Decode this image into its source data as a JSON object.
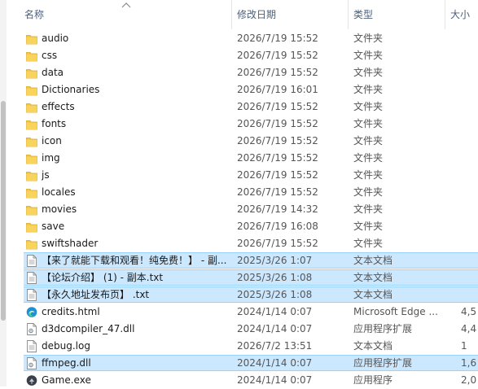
{
  "header": {
    "name": "名称",
    "date_modified": "修改日期",
    "type": "类型",
    "size": "大小"
  },
  "colors": {
    "selection_bg": "#cce8ff",
    "selection_border": "#99d1ff",
    "folder": "#f4c542",
    "header_text": "#4c607a"
  },
  "rows": [
    {
      "name": "audio",
      "date": "2026/7/19 15:52",
      "type": "文件夹",
      "size": "",
      "icon": "folder-icon"
    },
    {
      "name": "css",
      "date": "2026/7/19 15:52",
      "type": "文件夹",
      "size": "",
      "icon": "folder-icon"
    },
    {
      "name": "data",
      "date": "2026/7/19 15:52",
      "type": "文件夹",
      "size": "",
      "icon": "folder-icon"
    },
    {
      "name": "Dictionaries",
      "date": "2026/7/19 16:01",
      "type": "文件夹",
      "size": "",
      "icon": "folder-icon"
    },
    {
      "name": "effects",
      "date": "2026/7/19 15:52",
      "type": "文件夹",
      "size": "",
      "icon": "folder-icon"
    },
    {
      "name": "fonts",
      "date": "2026/7/19 15:52",
      "type": "文件夹",
      "size": "",
      "icon": "folder-icon"
    },
    {
      "name": "icon",
      "date": "2026/7/19 15:52",
      "type": "文件夹",
      "size": "",
      "icon": "folder-icon"
    },
    {
      "name": "img",
      "date": "2026/7/19 15:52",
      "type": "文件夹",
      "size": "",
      "icon": "folder-icon"
    },
    {
      "name": "js",
      "date": "2026/7/19 15:52",
      "type": "文件夹",
      "size": "",
      "icon": "folder-icon"
    },
    {
      "name": "locales",
      "date": "2026/7/19 15:52",
      "type": "文件夹",
      "size": "",
      "icon": "folder-icon"
    },
    {
      "name": "movies",
      "date": "2026/7/19 14:32",
      "type": "文件夹",
      "size": "",
      "icon": "folder-icon"
    },
    {
      "name": "save",
      "date": "2026/7/19 16:08",
      "type": "文件夹",
      "size": "",
      "icon": "folder-icon"
    },
    {
      "name": "swiftshader",
      "date": "2026/7/19 15:52",
      "type": "文件夹",
      "size": "",
      "icon": "folder-icon"
    },
    {
      "name": "【来了就能下载和观看！纯免费！】 - 副...",
      "date": "2025/3/26 1:07",
      "type": "文本文档",
      "size": "",
      "icon": "text-file-icon",
      "selected": true
    },
    {
      "name": "【论坛介绍】 (1) - 副本.txt",
      "date": "2025/3/26 1:08",
      "type": "文本文档",
      "size": "",
      "icon": "text-file-icon",
      "selected": true
    },
    {
      "name": "【永久地址发布页】 .txt",
      "date": "2025/3/26 1:08",
      "type": "文本文档",
      "size": "",
      "icon": "text-file-icon",
      "selected": true
    },
    {
      "name": "credits.html",
      "date": "2024/1/14 0:07",
      "type": "Microsoft Edge ...",
      "size": "4,5",
      "icon": "edge-icon"
    },
    {
      "name": "d3dcompiler_47.dll",
      "date": "2024/1/14 0:07",
      "type": "应用程序扩展",
      "size": "4,4",
      "icon": "dll-file-icon"
    },
    {
      "name": "debug.log",
      "date": "2026/7/2 13:51",
      "type": "文本文档",
      "size": "1",
      "icon": "text-file-icon"
    },
    {
      "name": "ffmpeg.dll",
      "date": "2024/1/14 0:07",
      "type": "应用程序扩展",
      "size": "1,6",
      "icon": "dll-file-icon",
      "selected": true
    },
    {
      "name": "Game.exe",
      "date": "2024/1/14 0:07",
      "type": "应用程序",
      "size": "2,0",
      "icon": "game-exe-icon"
    }
  ]
}
